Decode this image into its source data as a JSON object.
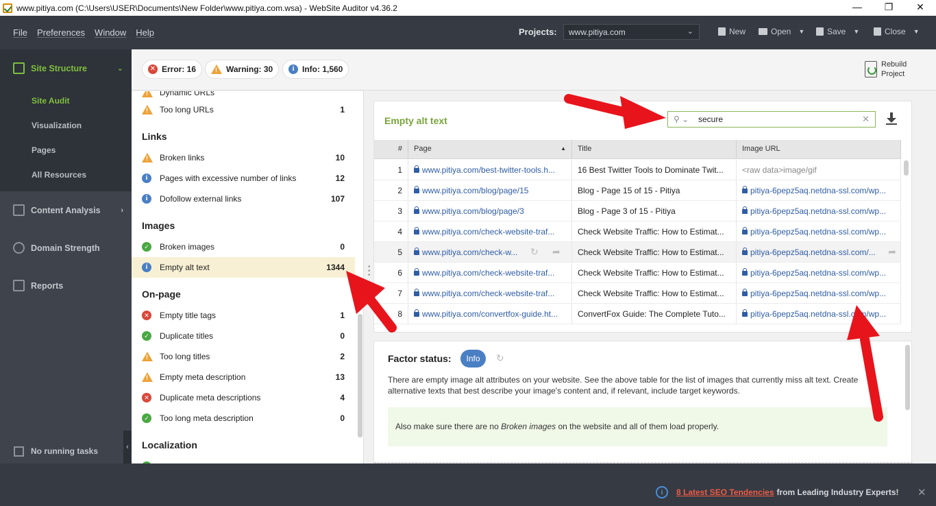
{
  "window": {
    "title": "www.pitiya.com (C:\\Users\\USER\\Documents\\New Folder\\www.pitiya.com.wsa) - WebSite Auditor v4.36.2",
    "minimize": "—",
    "maximize": "❐",
    "close": "✕"
  },
  "menu": [
    "File",
    "Preferences",
    "Window",
    "Help"
  ],
  "toolbar": {
    "projects_label": "Projects:",
    "project_value": "www.pitiya.com",
    "new_label": "New",
    "open_label": "Open",
    "save_label": "Save",
    "close_label": "Close"
  },
  "sidebar": {
    "active_section": "Site Structure",
    "sub_items": [
      "Site Audit",
      "Visualization",
      "Pages",
      "All Resources"
    ],
    "sections": [
      "Content Analysis",
      "Domain Strength",
      "Reports"
    ],
    "bottom": "No running tasks"
  },
  "badges": {
    "error": "Error: 16",
    "warning": "Warning: 30",
    "info": "Info: 1,560"
  },
  "rebuild": {
    "line1": "Rebuild",
    "line2": "Project"
  },
  "issues": {
    "partial_top": "Dynamic URLs",
    "too_long_urls": {
      "label": "Too long URLs",
      "value": "1"
    },
    "links_head": "Links",
    "broken_links": {
      "label": "Broken links",
      "value": "10"
    },
    "excessive_links": {
      "label": "Pages with excessive number of links",
      "value": "12"
    },
    "dofollow": {
      "label": "Dofollow external links",
      "value": "107"
    },
    "images_head": "Images",
    "broken_images": {
      "label": "Broken images",
      "value": "0"
    },
    "empty_alt": {
      "label": "Empty alt text",
      "value": "1344"
    },
    "onpage_head": "On-page",
    "empty_title": {
      "label": "Empty title tags",
      "value": "1"
    },
    "dup_titles": {
      "label": "Duplicate titles",
      "value": "0"
    },
    "long_titles": {
      "label": "Too long titles",
      "value": "2"
    },
    "empty_meta": {
      "label": "Empty meta description",
      "value": "13"
    },
    "dup_meta": {
      "label": "Duplicate meta descriptions",
      "value": "4"
    },
    "long_meta": {
      "label": "Too long meta description",
      "value": "0"
    },
    "localization_head": "Localization"
  },
  "panel": {
    "title": "Empty alt text",
    "search_value": "secure",
    "columns": [
      "#",
      "Page",
      "Title",
      "Image URL"
    ],
    "rows": [
      {
        "n": "1",
        "page": "www.pitiya.com/best-twitter-tools.h...",
        "title": "16 Best Twitter Tools to Dominate Twit...",
        "img": "<raw data>image/gif"
      },
      {
        "n": "2",
        "page": "www.pitiya.com/blog/page/15",
        "title": "Blog - Page 15 of 15 - Pitiya",
        "img": "pitiya-6pepz5aq.netdna-ssl.com/wp..."
      },
      {
        "n": "3",
        "page": "www.pitiya.com/blog/page/3",
        "title": "Blog - Page 3 of 15 - Pitiya",
        "img": "pitiya-6pepz5aq.netdna-ssl.com/wp..."
      },
      {
        "n": "4",
        "page": "www.pitiya.com/check-website-traf...",
        "title": "Check Website Traffic: How to Estimat...",
        "img": "pitiya-6pepz5aq.netdna-ssl.com/wp..."
      },
      {
        "n": "5",
        "page": "www.pitiya.com/check-w...",
        "title": "Check Website Traffic: How to Estimat...",
        "img": "pitiya-6pepz5aq.netdna-ssl.com/..."
      },
      {
        "n": "6",
        "page": "www.pitiya.com/check-website-traf...",
        "title": "Check Website Traffic: How to Estimat...",
        "img": "pitiya-6pepz5aq.netdna-ssl.com/wp..."
      },
      {
        "n": "7",
        "page": "www.pitiya.com/check-website-traf...",
        "title": "Check Website Traffic: How to Estimat...",
        "img": "pitiya-6pepz5aq.netdna-ssl.com/wp..."
      },
      {
        "n": "8",
        "page": "www.pitiya.com/convertfox-guide.ht...",
        "title": "ConvertFox Guide: The Complete Tuto...",
        "img": "pitiya-6pepz5aq.netdna-ssl.com/wp..."
      }
    ]
  },
  "factor": {
    "title": "Factor status:",
    "pill": "Info",
    "text": "There are empty image alt attributes on your website. See the above table for the list of images that currently miss alt text. Create alternative texts that best describe your image's content and, if relevant, include target keywords.",
    "note_before": "Also make sure there are no ",
    "note_em": "Broken images",
    "note_after": " on the website and all of them load properly."
  },
  "promo": {
    "link": "8 Latest SEO Tendencies",
    "rest": "from Leading Industry Experts!"
  },
  "colors": {
    "accent_green": "#79a33b",
    "error": "#d9483b",
    "warning": "#eba33a",
    "info": "#4a7fc4",
    "ok": "#4aa843",
    "annotation_arrow": "#e8141c"
  }
}
